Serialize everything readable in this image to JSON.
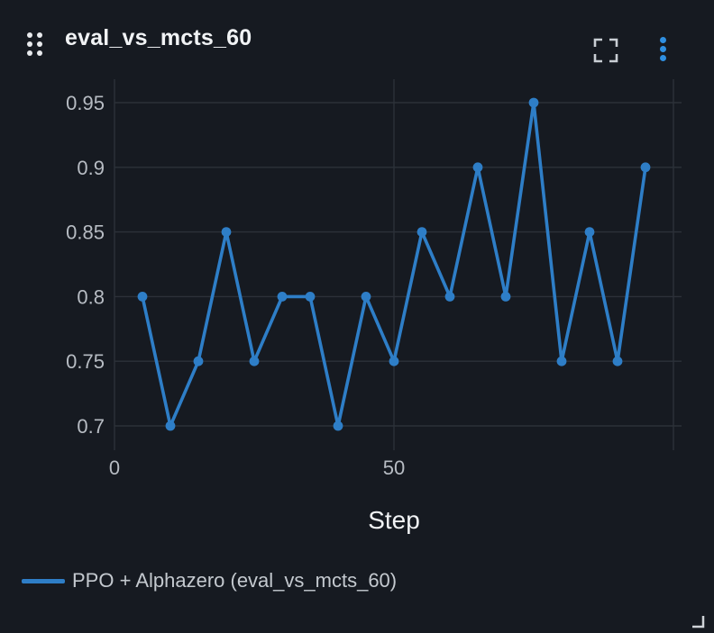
{
  "panel": {
    "title": "eval_vs_mcts_60",
    "icons": {
      "drag": "drag-handle-icon",
      "fullscreen": "fullscreen-icon",
      "more": "more-vertical-icon",
      "resize": "resize-corner-icon"
    }
  },
  "legend": {
    "label": "PPO + Alphazero (eval_vs_mcts_60)",
    "color": "#2e7ec7"
  },
  "chart_data": {
    "type": "line",
    "xlabel": "Step",
    "ylabel": "",
    "xlim": [
      0,
      100
    ],
    "ylim": [
      0.68,
      0.965
    ],
    "xticks": [
      0,
      50
    ],
    "xtick_labels": [
      "0",
      "50"
    ],
    "yticks": [
      0.7,
      0.75,
      0.8,
      0.85,
      0.9,
      0.95
    ],
    "ytick_labels": [
      "0.7",
      "0.75",
      "0.8",
      "0.85",
      "0.9",
      "0.95"
    ],
    "grid": true,
    "legend_position": "bottom-left",
    "series": [
      {
        "name": "PPO + Alphazero (eval_vs_mcts_60)",
        "color": "#2e7ec7",
        "x": [
          5,
          10,
          15,
          20,
          25,
          30,
          35,
          40,
          45,
          50,
          55,
          60,
          65,
          70,
          75,
          80,
          85,
          90,
          95
        ],
        "y": [
          0.8,
          0.7,
          0.75,
          0.85,
          0.75,
          0.8,
          0.8,
          0.7,
          0.8,
          0.75,
          0.85,
          0.8,
          0.9,
          0.8,
          0.95,
          0.75,
          0.85,
          0.75,
          0.9
        ]
      }
    ]
  }
}
